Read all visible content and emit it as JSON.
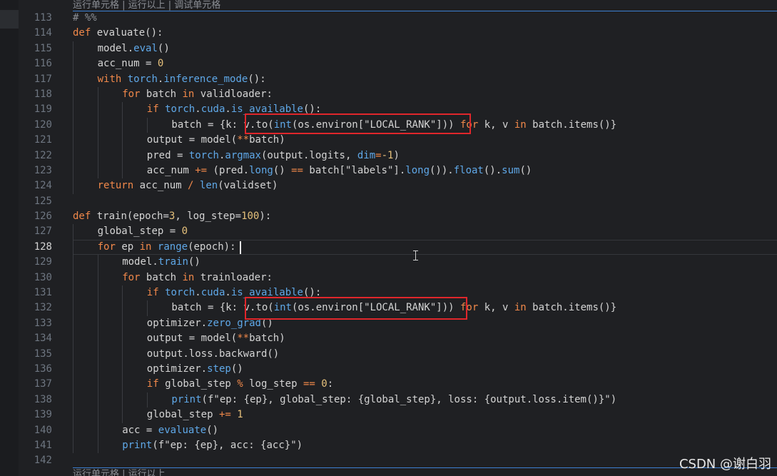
{
  "codelens": {
    "top": "运行单元格 | 运行以上 | 调试单元格",
    "bottom": "运行单元格 | 运行以上"
  },
  "cursor_line": 128,
  "highlight_color": "#e0262b",
  "watermark": "CSDN @谢白羽",
  "lines": [
    {
      "num": "113",
      "indent": 0,
      "tokens": [
        {
          "t": "# %%",
          "c": "cm"
        }
      ]
    },
    {
      "num": "114",
      "indent": 0,
      "tokens": [
        {
          "t": "def",
          "c": "kw"
        },
        {
          "t": " ",
          "c": ""
        },
        {
          "t": "evaluate",
          "c": "fn"
        },
        {
          "t": "():",
          "c": ""
        }
      ]
    },
    {
      "num": "115",
      "indent": 1,
      "tokens": [
        {
          "t": "model.",
          "c": ""
        },
        {
          "t": "eval",
          "c": "bi"
        },
        {
          "t": "()",
          "c": ""
        }
      ]
    },
    {
      "num": "116",
      "indent": 1,
      "tokens": [
        {
          "t": "acc_num = ",
          "c": ""
        },
        {
          "t": "0",
          "c": "num"
        }
      ]
    },
    {
      "num": "117",
      "indent": 1,
      "tokens": [
        {
          "t": "with",
          "c": "kw"
        },
        {
          "t": " ",
          "c": ""
        },
        {
          "t": "torch",
          "c": "bi"
        },
        {
          "t": ".",
          "c": ""
        },
        {
          "t": "inference_mode",
          "c": "bi"
        },
        {
          "t": "():",
          "c": ""
        }
      ]
    },
    {
      "num": "118",
      "indent": 2,
      "tokens": [
        {
          "t": "for",
          "c": "kw"
        },
        {
          "t": " batch ",
          "c": ""
        },
        {
          "t": "in",
          "c": "kw"
        },
        {
          "t": " validloader:",
          "c": ""
        }
      ]
    },
    {
      "num": "119",
      "indent": 3,
      "tokens": [
        {
          "t": "if",
          "c": "kw"
        },
        {
          "t": " ",
          "c": ""
        },
        {
          "t": "torch",
          "c": "bi"
        },
        {
          "t": ".",
          "c": ""
        },
        {
          "t": "cuda",
          "c": "bi"
        },
        {
          "t": ".",
          "c": ""
        },
        {
          "t": "is_available",
          "c": "bi"
        },
        {
          "t": "():",
          "c": ""
        }
      ]
    },
    {
      "num": "120",
      "indent": 4,
      "tokens": [
        {
          "t": "batch = {k: v.to(",
          "c": ""
        },
        {
          "t": "int",
          "c": "bi"
        },
        {
          "t": "(os.environ[\"LOCAL_RANK\"])) ",
          "c": ""
        },
        {
          "t": "for",
          "c": "kw"
        },
        {
          "t": " k, v ",
          "c": ""
        },
        {
          "t": "in",
          "c": "kw"
        },
        {
          "t": " batch.items()}",
          "c": ""
        }
      ]
    },
    {
      "num": "121",
      "indent": 3,
      "tokens": [
        {
          "t": "output = model(",
          "c": ""
        },
        {
          "t": "**",
          "c": "op"
        },
        {
          "t": "batch)",
          "c": ""
        }
      ]
    },
    {
      "num": "122",
      "indent": 3,
      "tokens": [
        {
          "t": "pred = ",
          "c": ""
        },
        {
          "t": "torch",
          "c": "bi"
        },
        {
          "t": ".",
          "c": ""
        },
        {
          "t": "argmax",
          "c": "bi"
        },
        {
          "t": "(output.logits, ",
          "c": ""
        },
        {
          "t": "dim",
          "c": "bi"
        },
        {
          "t": "=",
          "c": "op"
        },
        {
          "t": "-1",
          "c": "num"
        },
        {
          "t": ")",
          "c": ""
        }
      ]
    },
    {
      "num": "123",
      "indent": 3,
      "tokens": [
        {
          "t": "acc_num ",
          "c": ""
        },
        {
          "t": "+=",
          "c": "op"
        },
        {
          "t": " (pred.",
          "c": ""
        },
        {
          "t": "long",
          "c": "bi"
        },
        {
          "t": "() ",
          "c": ""
        },
        {
          "t": "==",
          "c": "op"
        },
        {
          "t": " batch[\"labels\"].",
          "c": ""
        },
        {
          "t": "long",
          "c": "bi"
        },
        {
          "t": "()).",
          "c": ""
        },
        {
          "t": "float",
          "c": "bi"
        },
        {
          "t": "().",
          "c": ""
        },
        {
          "t": "sum",
          "c": "bi"
        },
        {
          "t": "()",
          "c": ""
        }
      ]
    },
    {
      "num": "124",
      "indent": 1,
      "tokens": [
        {
          "t": "return",
          "c": "kw"
        },
        {
          "t": " acc_num ",
          "c": ""
        },
        {
          "t": "/",
          "c": "op"
        },
        {
          "t": " ",
          "c": ""
        },
        {
          "t": "len",
          "c": "bi"
        },
        {
          "t": "(validset)",
          "c": ""
        }
      ]
    },
    {
      "num": "125",
      "indent": 0,
      "tokens": []
    },
    {
      "num": "126",
      "indent": 0,
      "tokens": [
        {
          "t": "def",
          "c": "kw"
        },
        {
          "t": " ",
          "c": ""
        },
        {
          "t": "train",
          "c": "fn"
        },
        {
          "t": "(epoch=",
          "c": ""
        },
        {
          "t": "3",
          "c": "num"
        },
        {
          "t": ", log_step=",
          "c": ""
        },
        {
          "t": "100",
          "c": "num"
        },
        {
          "t": "):",
          "c": ""
        }
      ]
    },
    {
      "num": "127",
      "indent": 1,
      "tokens": [
        {
          "t": "global_step = ",
          "c": ""
        },
        {
          "t": "0",
          "c": "num"
        }
      ]
    },
    {
      "num": "128",
      "indent": 1,
      "tokens": [
        {
          "t": "for",
          "c": "kw"
        },
        {
          "t": " ep ",
          "c": ""
        },
        {
          "t": "in",
          "c": "kw"
        },
        {
          "t": " ",
          "c": ""
        },
        {
          "t": "range",
          "c": "bi"
        },
        {
          "t": "(epoch):",
          "c": ""
        }
      ]
    },
    {
      "num": "129",
      "indent": 2,
      "tokens": [
        {
          "t": "model.",
          "c": ""
        },
        {
          "t": "train",
          "c": "bi"
        },
        {
          "t": "()",
          "c": ""
        }
      ]
    },
    {
      "num": "130",
      "indent": 2,
      "tokens": [
        {
          "t": "for",
          "c": "kw"
        },
        {
          "t": " batch ",
          "c": ""
        },
        {
          "t": "in",
          "c": "kw"
        },
        {
          "t": " trainloader:",
          "c": ""
        }
      ]
    },
    {
      "num": "131",
      "indent": 3,
      "tokens": [
        {
          "t": "if",
          "c": "kw"
        },
        {
          "t": " ",
          "c": ""
        },
        {
          "t": "torch",
          "c": "bi"
        },
        {
          "t": ".",
          "c": ""
        },
        {
          "t": "cuda",
          "c": "bi"
        },
        {
          "t": ".",
          "c": ""
        },
        {
          "t": "is_available",
          "c": "bi"
        },
        {
          "t": "():",
          "c": ""
        }
      ]
    },
    {
      "num": "132",
      "indent": 4,
      "tokens": [
        {
          "t": "batch = {k: v.to(",
          "c": ""
        },
        {
          "t": "int",
          "c": "bi"
        },
        {
          "t": "(os.environ[\"LOCAL_RANK\"])) ",
          "c": ""
        },
        {
          "t": "for",
          "c": "kw"
        },
        {
          "t": " k, v ",
          "c": ""
        },
        {
          "t": "in",
          "c": "kw"
        },
        {
          "t": " batch.items()}",
          "c": ""
        }
      ]
    },
    {
      "num": "133",
      "indent": 3,
      "tokens": [
        {
          "t": "optimizer.",
          "c": ""
        },
        {
          "t": "zero_grad",
          "c": "bi"
        },
        {
          "t": "()",
          "c": ""
        }
      ]
    },
    {
      "num": "134",
      "indent": 3,
      "tokens": [
        {
          "t": "output = model(",
          "c": ""
        },
        {
          "t": "**",
          "c": "op"
        },
        {
          "t": "batch)",
          "c": ""
        }
      ]
    },
    {
      "num": "135",
      "indent": 3,
      "tokens": [
        {
          "t": "output.loss.backward()",
          "c": ""
        }
      ]
    },
    {
      "num": "136",
      "indent": 3,
      "tokens": [
        {
          "t": "optimizer.",
          "c": ""
        },
        {
          "t": "step",
          "c": "bi"
        },
        {
          "t": "()",
          "c": ""
        }
      ]
    },
    {
      "num": "137",
      "indent": 3,
      "tokens": [
        {
          "t": "if",
          "c": "kw"
        },
        {
          "t": " global_step ",
          "c": ""
        },
        {
          "t": "%",
          "c": "op"
        },
        {
          "t": " log_step ",
          "c": ""
        },
        {
          "t": "==",
          "c": "op"
        },
        {
          "t": " ",
          "c": ""
        },
        {
          "t": "0",
          "c": "num"
        },
        {
          "t": ":",
          "c": ""
        }
      ]
    },
    {
      "num": "138",
      "indent": 4,
      "tokens": [
        {
          "t": "print",
          "c": "bi"
        },
        {
          "t": "(f\"ep: {ep}, global_step: {global_step}, loss: {output.loss.item()}\")",
          "c": ""
        }
      ]
    },
    {
      "num": "139",
      "indent": 3,
      "tokens": [
        {
          "t": "global_step ",
          "c": ""
        },
        {
          "t": "+=",
          "c": "op"
        },
        {
          "t": " ",
          "c": ""
        },
        {
          "t": "1",
          "c": "num"
        }
      ]
    },
    {
      "num": "140",
      "indent": 2,
      "tokens": [
        {
          "t": "acc = ",
          "c": ""
        },
        {
          "t": "evaluate",
          "c": "bi"
        },
        {
          "t": "()",
          "c": ""
        }
      ]
    },
    {
      "num": "141",
      "indent": 2,
      "tokens": [
        {
          "t": "print",
          "c": "bi"
        },
        {
          "t": "(f\"ep: {ep}, acc: {acc}\")",
          "c": ""
        }
      ]
    },
    {
      "num": "142",
      "indent": 0,
      "tokens": []
    }
  ]
}
